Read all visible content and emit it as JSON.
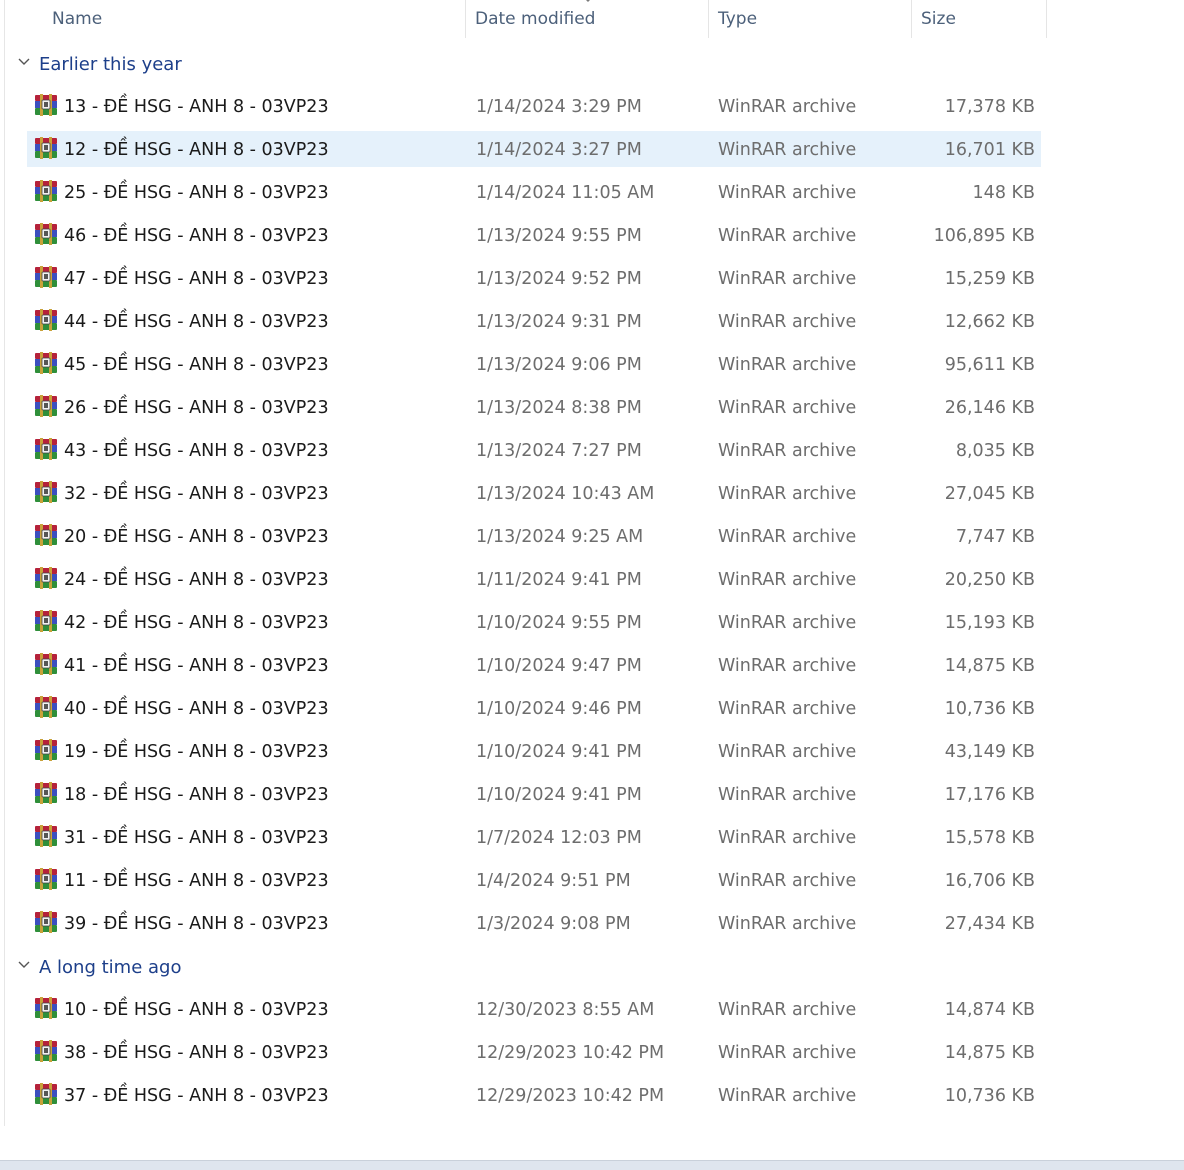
{
  "header": {
    "name_label": "Name",
    "date_label": "Date modified",
    "type_label": "Type",
    "size_label": "Size"
  },
  "groups": [
    {
      "label": "Earlier this year",
      "files": [
        {
          "name": "13 - ĐỀ HSG - ANH 8 - 03VP23",
          "date": "1/14/2024 3:29 PM",
          "type": "WinRAR archive",
          "size": "17,378 KB"
        },
        {
          "name": "12 - ĐỀ HSG - ANH 8 - 03VP23",
          "date": "1/14/2024 3:27 PM",
          "type": "WinRAR archive",
          "size": "16,701 KB"
        },
        {
          "name": "25 - ĐỀ HSG - ANH 8 - 03VP23",
          "date": "1/14/2024 11:05 AM",
          "type": "WinRAR archive",
          "size": "148 KB"
        },
        {
          "name": "46 - ĐỀ HSG - ANH 8 - 03VP23",
          "date": "1/13/2024 9:55 PM",
          "type": "WinRAR archive",
          "size": "106,895 KB"
        },
        {
          "name": "47 - ĐỀ HSG - ANH 8 - 03VP23",
          "date": "1/13/2024 9:52 PM",
          "type": "WinRAR archive",
          "size": "15,259 KB"
        },
        {
          "name": "44 - ĐỀ HSG - ANH 8 - 03VP23",
          "date": "1/13/2024 9:31 PM",
          "type": "WinRAR archive",
          "size": "12,662 KB"
        },
        {
          "name": "45 - ĐỀ HSG - ANH 8 - 03VP23",
          "date": "1/13/2024 9:06 PM",
          "type": "WinRAR archive",
          "size": "95,611 KB"
        },
        {
          "name": "26 - ĐỀ HSG - ANH 8 - 03VP23",
          "date": "1/13/2024 8:38 PM",
          "type": "WinRAR archive",
          "size": "26,146 KB"
        },
        {
          "name": "43 - ĐỀ HSG - ANH 8 - 03VP23",
          "date": "1/13/2024 7:27 PM",
          "type": "WinRAR archive",
          "size": "8,035 KB"
        },
        {
          "name": "32 - ĐỀ HSG - ANH 8 - 03VP23",
          "date": "1/13/2024 10:43 AM",
          "type": "WinRAR archive",
          "size": "27,045 KB"
        },
        {
          "name": "20 - ĐỀ HSG - ANH 8 - 03VP23",
          "date": "1/13/2024 9:25 AM",
          "type": "WinRAR archive",
          "size": "7,747 KB"
        },
        {
          "name": "24 - ĐỀ HSG - ANH 8 - 03VP23",
          "date": "1/11/2024 9:41 PM",
          "type": "WinRAR archive",
          "size": "20,250 KB"
        },
        {
          "name": "42 - ĐỀ HSG - ANH 8 - 03VP23",
          "date": "1/10/2024 9:55 PM",
          "type": "WinRAR archive",
          "size": "15,193 KB"
        },
        {
          "name": "41 - ĐỀ HSG - ANH 8 - 03VP23",
          "date": "1/10/2024 9:47 PM",
          "type": "WinRAR archive",
          "size": "14,875 KB"
        },
        {
          "name": "40 - ĐỀ HSG - ANH 8 - 03VP23",
          "date": "1/10/2024 9:46 PM",
          "type": "WinRAR archive",
          "size": "10,736 KB"
        },
        {
          "name": "19 - ĐỀ HSG - ANH 8 - 03VP23",
          "date": "1/10/2024 9:41 PM",
          "type": "WinRAR archive",
          "size": "43,149 KB"
        },
        {
          "name": "18 - ĐỀ HSG - ANH 8 - 03VP23",
          "date": "1/10/2024 9:41 PM",
          "type": "WinRAR archive",
          "size": "17,176 KB"
        },
        {
          "name": "31 - ĐỀ HSG - ANH 8 - 03VP23",
          "date": "1/7/2024 12:03 PM",
          "type": "WinRAR archive",
          "size": "15,578 KB"
        },
        {
          "name": "11 - ĐỀ HSG - ANH 8 - 03VP23",
          "date": "1/4/2024 9:51 PM",
          "type": "WinRAR archive",
          "size": "16,706 KB"
        },
        {
          "name": "39 - ĐỀ HSG - ANH 8 - 03VP23",
          "date": "1/3/2024 9:08 PM",
          "type": "WinRAR archive",
          "size": "27,434 KB"
        }
      ]
    },
    {
      "label": "A long time ago",
      "files": [
        {
          "name": "10 - ĐỀ HSG - ANH 8 - 03VP23",
          "date": "12/30/2023 8:55 AM",
          "type": "WinRAR archive",
          "size": "14,874 KB"
        },
        {
          "name": "38 - ĐỀ HSG - ANH 8 - 03VP23",
          "date": "12/29/2023 10:42 PM",
          "type": "WinRAR archive",
          "size": "14,875 KB"
        },
        {
          "name": "37 - ĐỀ HSG - ANH 8 - 03VP23",
          "date": "12/29/2023 10:42 PM",
          "type": "WinRAR archive",
          "size": "10,736 KB"
        }
      ]
    }
  ],
  "selected_file": "12 - ĐỀ HSG - ANH 8 - 03VP23",
  "icon_name": "winrar-archive-icon",
  "colors": {
    "group_label": "#1d3f8a",
    "selection_bg": "#e5f1fb",
    "header_text": "#4c607a",
    "secondary_text": "#6d6d6d"
  }
}
